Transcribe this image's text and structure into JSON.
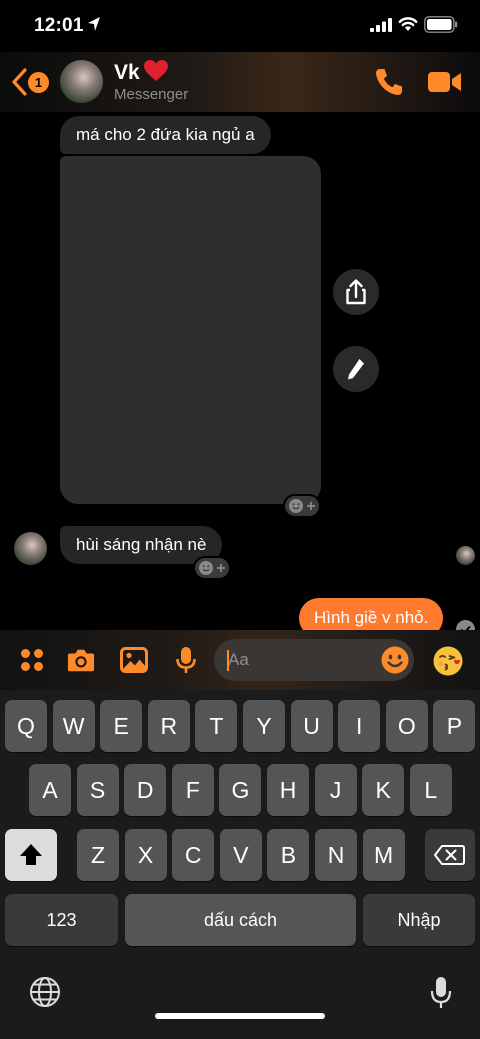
{
  "status_bar": {
    "time": "12:01"
  },
  "header": {
    "back_badge": "1",
    "contact_name": "Vk",
    "subtitle": "Messenger",
    "accent": "#ff8a2a"
  },
  "messages": [
    {
      "direction": "in",
      "text": "má cho 2 đứa kia ngủ a"
    },
    {
      "direction": "in",
      "type": "photo"
    },
    {
      "direction": "in",
      "text": "hùi sáng nhận nè"
    },
    {
      "direction": "out",
      "text": "Hình giề v nhỏ."
    }
  ],
  "composer": {
    "placeholder": "Aa",
    "icons": [
      "apps-icon",
      "camera-icon",
      "gallery-icon",
      "mic-icon",
      "emoji-icon",
      "kiss-emoji-icon"
    ]
  },
  "keyboard": {
    "row1": [
      "Q",
      "W",
      "E",
      "R",
      "T",
      "Y",
      "U",
      "I",
      "O",
      "P"
    ],
    "row2": [
      "A",
      "S",
      "D",
      "F",
      "G",
      "H",
      "J",
      "K",
      "L"
    ],
    "row3": [
      "Z",
      "X",
      "C",
      "V",
      "B",
      "N",
      "M"
    ],
    "numbers": "123",
    "space": "dấu cách",
    "return": "Nhập"
  }
}
